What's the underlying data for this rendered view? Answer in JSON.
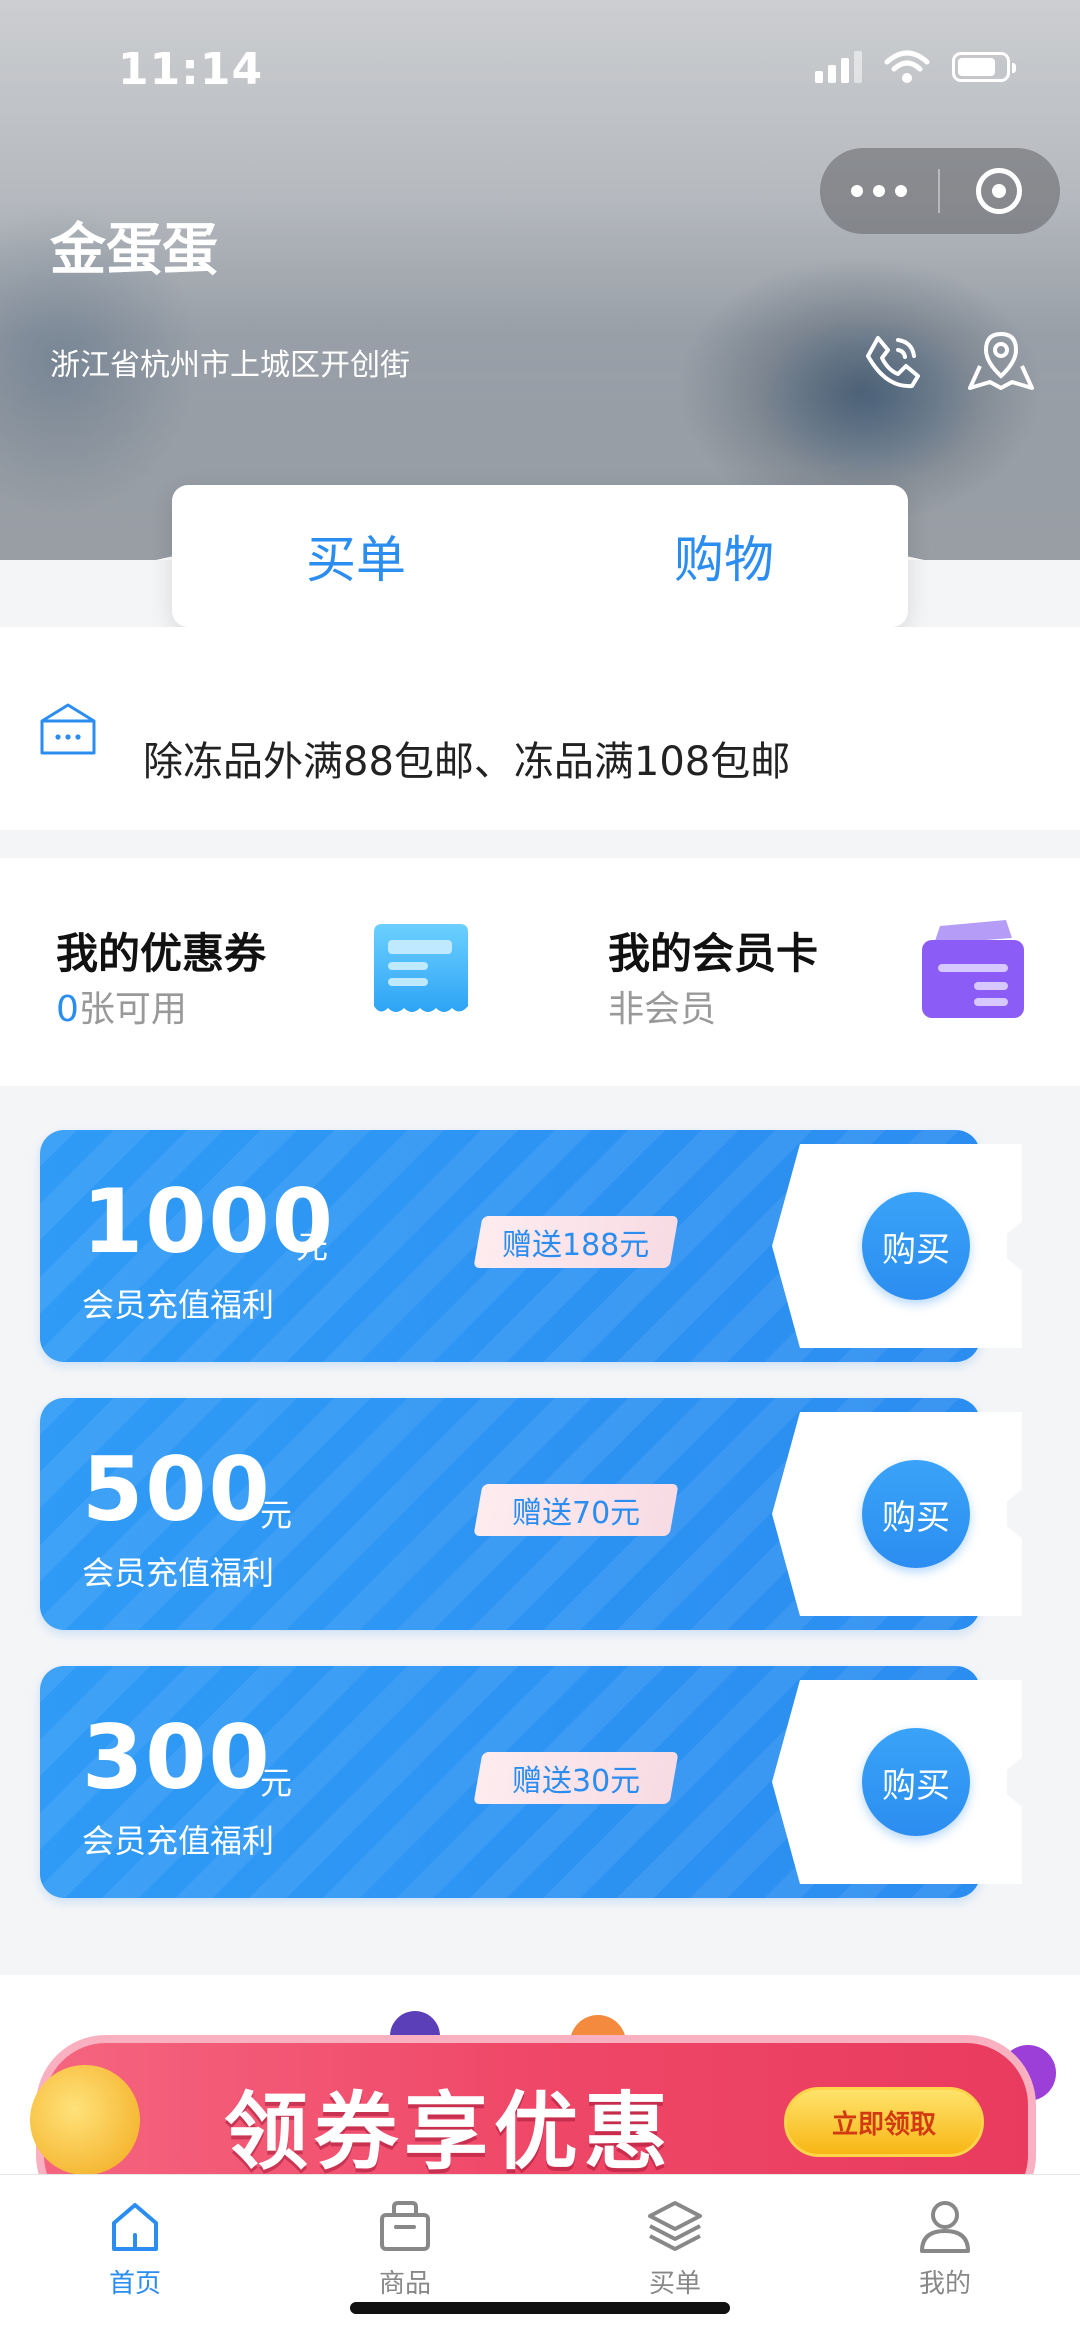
{
  "status_bar": {
    "time": "11:14"
  },
  "store": {
    "name": "金蛋蛋",
    "address": "浙江省杭州市上城区开创街"
  },
  "tabs": [
    {
      "label": "买单"
    },
    {
      "label": "购物"
    }
  ],
  "notice": {
    "line": "除冻品外满88包邮、冻品满108包邮"
  },
  "coupon": {
    "title": "我的优惠券",
    "count": "0",
    "suffix": "张可用"
  },
  "member_card": {
    "title": "我的会员卡",
    "status": "非会员"
  },
  "recharge": [
    {
      "amount": "1000",
      "unit": "元",
      "desc": "会员充值福利",
      "gift": "赠送188元",
      "buy_label": "购买"
    },
    {
      "amount": "500",
      "unit": "元",
      "desc": "会员充值福利",
      "gift": "赠送70元",
      "buy_label": "购买"
    },
    {
      "amount": "300",
      "unit": "元",
      "desc": "会员充值福利",
      "gift": "赠送30元",
      "buy_label": "购买"
    }
  ],
  "banner": {
    "text": "领券享优惠",
    "button": "立即领取"
  },
  "nav": [
    {
      "label": "首页",
      "icon": "home-icon",
      "active": true
    },
    {
      "label": "商品",
      "icon": "bag-icon",
      "active": false
    },
    {
      "label": "买单",
      "icon": "layers-icon",
      "active": false
    },
    {
      "label": "我的",
      "icon": "user-icon",
      "active": false
    }
  ],
  "colors": {
    "accent": "#2b8df0",
    "card_blue": "#2f9bf6",
    "member_purple": "#8b5cf6",
    "banner_red": "#ef4767"
  }
}
